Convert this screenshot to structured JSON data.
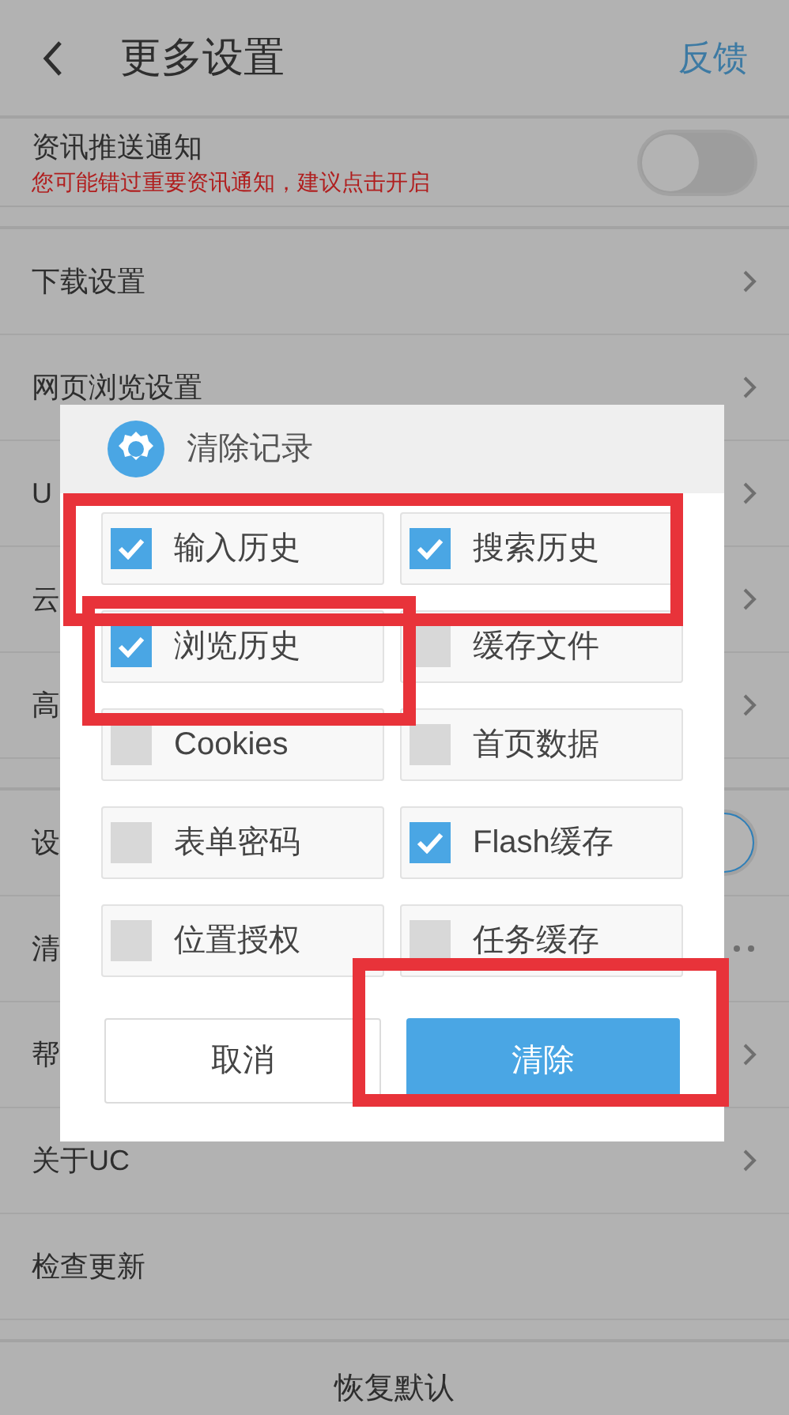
{
  "header": {
    "title": "更多设置",
    "action": "反馈"
  },
  "push": {
    "title": "资讯推送通知",
    "warning": "您可能错过重要资讯通知，建议点击开启",
    "on": false
  },
  "groups": [
    {
      "items": [
        {
          "label": "下载设置",
          "kind": "link"
        },
        {
          "label": "网页浏览设置",
          "kind": "link"
        },
        {
          "label": "U",
          "kind": "link"
        },
        {
          "label": "云",
          "kind": "link"
        },
        {
          "label": "高",
          "kind": "link"
        }
      ]
    },
    {
      "items": [
        {
          "label": "设",
          "kind": "toggle",
          "on": true
        },
        {
          "label": "清",
          "kind": "more"
        },
        {
          "label": "帮",
          "kind": "link"
        },
        {
          "label": "关于UC",
          "kind": "link"
        },
        {
          "label": "检查更新",
          "kind": "plain"
        }
      ]
    }
  ],
  "footer": "恢复默认",
  "dialog": {
    "title": "清除记录",
    "options": [
      {
        "label": "输入历史",
        "checked": true
      },
      {
        "label": "搜索历史",
        "checked": true
      },
      {
        "label": "浏览历史",
        "checked": true
      },
      {
        "label": "缓存文件",
        "checked": false
      },
      {
        "label": "Cookies",
        "checked": false
      },
      {
        "label": "首页数据",
        "checked": false
      },
      {
        "label": "表单密码",
        "checked": false
      },
      {
        "label": "Flash缓存",
        "checked": true
      },
      {
        "label": "位置授权",
        "checked": false
      },
      {
        "label": "任务缓存",
        "checked": false
      }
    ],
    "cancel": "取消",
    "confirm": "清除"
  }
}
